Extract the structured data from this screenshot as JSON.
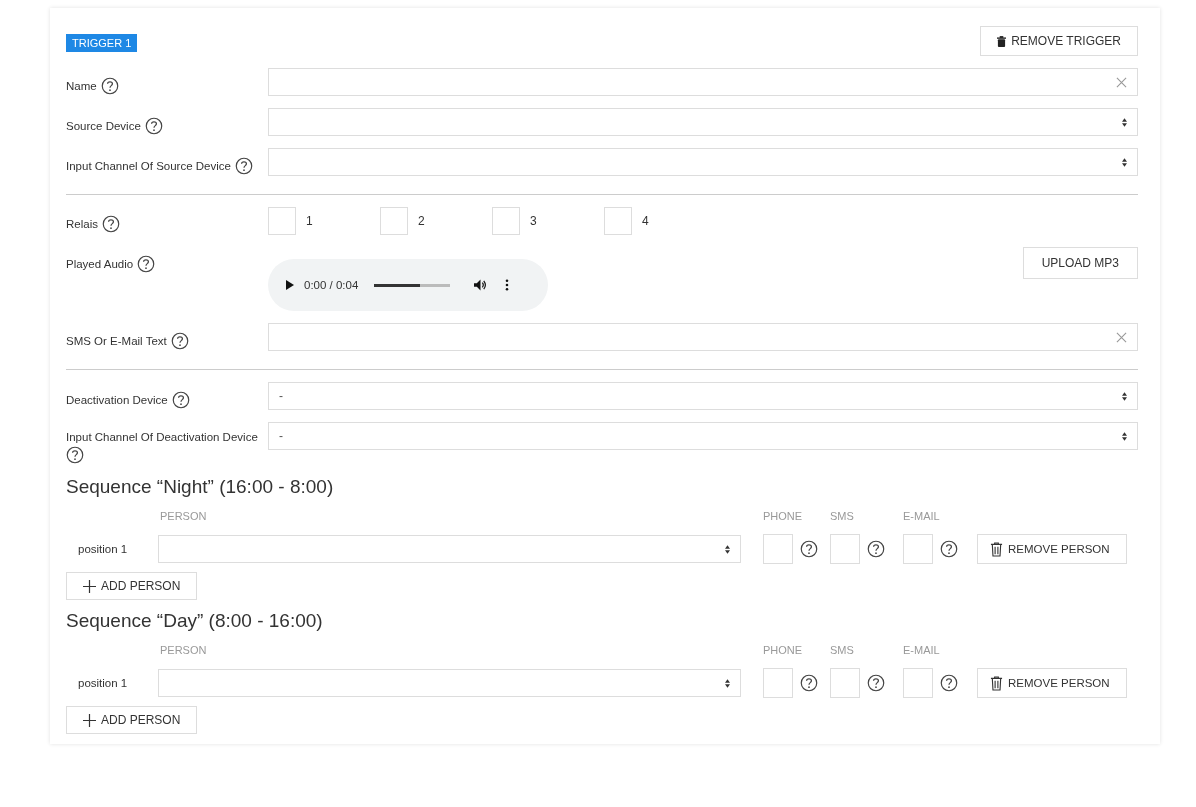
{
  "trigger": {
    "badge": "TRIGGER 1",
    "remove_button": "REMOVE TRIGGER"
  },
  "fields": [
    {
      "kind": "text",
      "label": "Name"
    },
    {
      "kind": "select",
      "label": "Source Device"
    },
    {
      "kind": "select",
      "label": "Input Channel Of Source Device"
    },
    {
      "kind": "divider"
    },
    {
      "kind": "checkboxes",
      "label": "Relais",
      "options": [
        {
          "label": "1",
          "checked": false
        },
        {
          "label": "2",
          "checked": false
        },
        {
          "label": "3",
          "checked": false
        },
        {
          "label": "4",
          "checked": false
        }
      ]
    },
    {
      "kind": "audio",
      "label": "Played Audio",
      "time": "0:00 / 0:04",
      "level": 0.6,
      "upload_button": "UPLOAD MP3"
    },
    {
      "kind": "text",
      "label": "SMS Or E-Mail Text"
    },
    {
      "kind": "divider"
    },
    {
      "kind": "select",
      "label": "Deactivation Device",
      "value": "-"
    },
    {
      "kind": "select",
      "label": "Input Channel Of Deactivation Device",
      "value": "-"
    }
  ],
  "sequences": [
    {
      "title": "Sequence “Night” (16:00 - 8:00)",
      "columns": [
        "PERSON",
        "PHONE",
        "SMS",
        "E-MAIL"
      ],
      "positions": [
        {
          "label": "position 1",
          "phone": false,
          "sms": false,
          "email": false,
          "remove_button": "REMOVE PERSON"
        }
      ],
      "add_button": "ADD PERSON"
    },
    {
      "title": "Sequence “Day” (8:00 - 16:00)",
      "columns": [
        "PERSON",
        "PHONE",
        "SMS",
        "E-MAIL"
      ],
      "positions": [
        {
          "label": "position 1",
          "phone": false,
          "sms": false,
          "email": false,
          "remove_button": "REMOVE PERSON"
        }
      ],
      "add_button": "ADD PERSON"
    }
  ]
}
